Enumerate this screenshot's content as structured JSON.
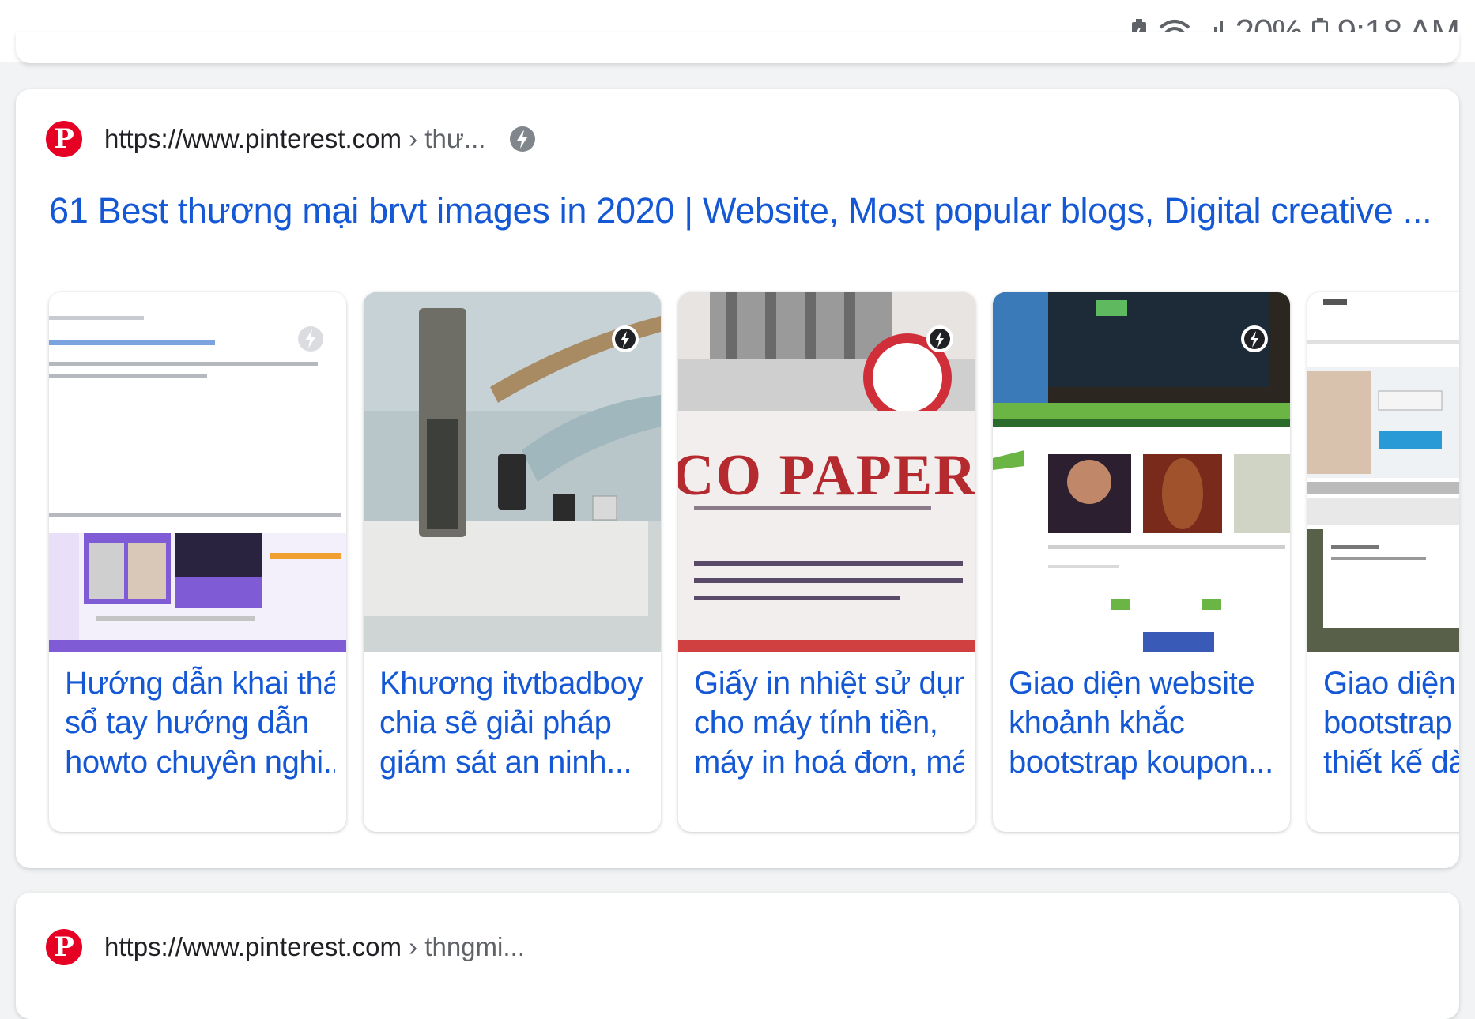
{
  "status_bar": {
    "battery_percent": "20%",
    "time": "9:18 AM",
    "icons": [
      "battery-saver-icon",
      "wifi-icon",
      "signal-icon",
      "battery-icon"
    ]
  },
  "result1": {
    "favicon": "pinterest-icon",
    "url_domain": "https://www.pinterest.com",
    "url_path": " › thư...",
    "title": "61 Best thương mại brvt images in 2020 | Website, Most popular blogs, Digital creative ...",
    "tiles": [
      {
        "line1": "Hướng dẫn khai thác",
        "line2": "sổ tay hướng dẫn",
        "line3": "howto chuyên nghi..."
      },
      {
        "line1": "Khương itvtbadboy",
        "line2": "chia sẽ giải pháp",
        "line3": "giám sát an ninh..."
      },
      {
        "line1": "Giấy in nhiệt sử dụng",
        "line2": "cho máy tính tiền,",
        "line3": "máy in hoá đơn, má...",
        "photo_text": "CO PAPER"
      },
      {
        "line1": "Giao diện website",
        "line2": "khoảnh khắc",
        "line3": "bootstrap koupon..."
      },
      {
        "line1": "Giao diện we",
        "line2": "bootstrap m",
        "line3": "thiết kế dành"
      }
    ]
  },
  "result2": {
    "favicon": "pinterest-icon",
    "url_domain": "https://www.pinterest.com",
    "url_path": " › thngmi..."
  },
  "colors": {
    "link_blue": "#1558d6",
    "pinterest_red": "#e60023",
    "background": "#f1f3f4"
  }
}
